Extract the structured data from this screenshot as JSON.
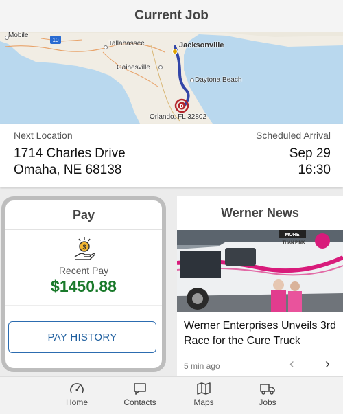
{
  "header": {
    "title": "Current Job"
  },
  "map": {
    "labels": {
      "mobile": "Mobile",
      "tallahassee": "Tallahassee",
      "jacksonville": "Jacksonville",
      "gainesville": "Gainesville",
      "daytona": "Daytona Beach",
      "orlando": "Orlando, FL 32802",
      "route_shield": "10",
      "destination_marker": "D"
    },
    "colors": {
      "water": "#b9d8ee",
      "land": "#f1ede4",
      "route": "#3346a8",
      "marker": "#b3262c"
    }
  },
  "job": {
    "next_location_label": "Next Location",
    "address_line1": "1714 Charles Drive",
    "address_line2": "Omaha, NE 68138",
    "scheduled_label": "Scheduled Arrival",
    "arrival_date": "Sep 29",
    "arrival_time": "16:30"
  },
  "pay": {
    "title": "Pay",
    "icon": "hand-coin-icon",
    "recent_label": "Recent Pay",
    "amount": "$1450.88",
    "history_button": "PAY HISTORY",
    "colors": {
      "amount": "#1a7a2b",
      "button": "#2c6cb0"
    }
  },
  "news": {
    "title": "Werner News",
    "image_banner_text": "MORE THAN PINK",
    "headline": "Werner Enterprises Unveils 3rd Race for the Cure Truck",
    "time": "5 min ago",
    "prev_icon": "chevron-left-icon",
    "next_icon": "chevron-right-icon"
  },
  "nav": {
    "items": [
      {
        "label": "Home",
        "icon": "speedometer-icon"
      },
      {
        "label": "Contacts",
        "icon": "chat-bubble-icon"
      },
      {
        "label": "Maps",
        "icon": "folded-map-icon"
      },
      {
        "label": "Jobs",
        "icon": "truck-icon"
      }
    ]
  }
}
